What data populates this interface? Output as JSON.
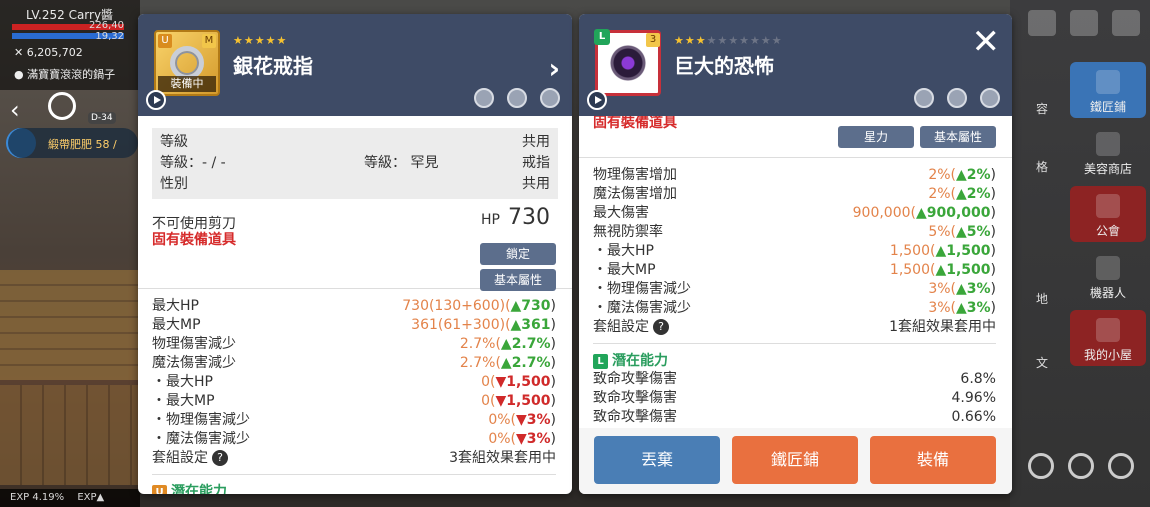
{
  "hud": {
    "level": "LV.252 Carry醬",
    "hp": "226,40",
    "mp": "19,32",
    "money": "6,205,702",
    "map": "滿寶寶滾滾的鍋子",
    "dday": "D-34",
    "quest": "緞帶肥肥 58 /",
    "exp": "EXP 4.19%",
    "exp2": "EXP▲"
  },
  "side_menu": {
    "blacksmith": "鐵匠鋪",
    "beauty": "美容商店",
    "guild": "公會",
    "robot": "機器人",
    "house": "我的小屋",
    "partial": [
      "容",
      "格",
      "地",
      "文"
    ]
  },
  "left_item": {
    "stars": "★★★★★",
    "name": "銀花戒指",
    "equipped_tag": "裝備中",
    "badge_u": "U",
    "badge_m": "M",
    "req": [
      {
        "left": "等級",
        "mid": "",
        "right": "共用"
      },
      {
        "left": "等級：- / -",
        "mid": "等級： 罕見",
        "right": "戒指"
      },
      {
        "left": "性別",
        "mid": "",
        "right": "共用"
      }
    ],
    "no_scissors": "不可使用剪刀",
    "unique_equip": "固有裝備道具",
    "hp_label": "HP",
    "hp_value": "730",
    "lock_btn": "鎖定",
    "basic_btn": "基本屬性",
    "stats": [
      {
        "label": "最大HP",
        "o": "730(130+600)(",
        "g": "▲730",
        "r": "",
        "end": ")"
      },
      {
        "label": "最大MP",
        "o": "361(61+300)(",
        "g": "▲361",
        "r": "",
        "end": ")"
      },
      {
        "label": "物理傷害減少",
        "o": "2.7%(",
        "g": "▲2.7%",
        "r": "",
        "end": ")"
      },
      {
        "label": "魔法傷害減少",
        "o": "2.7%(",
        "g": "▲2.7%",
        "r": "",
        "end": ")"
      },
      {
        "label": "・最大HP",
        "o": "0(",
        "g": "",
        "r": "▼1,500",
        "end": ")"
      },
      {
        "label": "・最大MP",
        "o": "0(",
        "g": "",
        "r": "▼1,500",
        "end": ")"
      },
      {
        "label": "・物理傷害減少",
        "o": "0%(",
        "g": "",
        "r": "▼3%",
        "end": ")"
      },
      {
        "label": "・魔法傷害減少",
        "o": "0%(",
        "g": "",
        "r": "▼3%",
        "end": ")"
      }
    ],
    "set_label": "套組設定",
    "set_value": "3套組效果套用中",
    "potential_title": "潛在能力"
  },
  "right_item": {
    "stars_on": "★★★",
    "stars_off": "★★★★★★★",
    "name": "巨大的恐怖",
    "badge_l": "L",
    "badge_3": "3",
    "unique_equip": "固有裝備道具",
    "starforce_btn": "星力",
    "basic_btn": "基本屬性",
    "stats": [
      {
        "label": "物理傷害增加",
        "o": "2%(",
        "g": "▲2%",
        "end": ")"
      },
      {
        "label": "魔法傷害增加",
        "o": "2%(",
        "g": "▲2%",
        "end": ")"
      },
      {
        "label": "最大傷害",
        "o": "900,000(",
        "g": "▲900,000",
        "end": ")"
      },
      {
        "label": "無視防禦率",
        "o": "5%(",
        "g": "▲5%",
        "end": ")"
      },
      {
        "label": "・最大HP",
        "o": "1,500(",
        "g": "▲1,500",
        "end": ")"
      },
      {
        "label": "・最大MP",
        "o": "1,500(",
        "g": "▲1,500",
        "end": ")"
      },
      {
        "label": "・物理傷害減少",
        "o": "3%(",
        "g": "▲3%",
        "end": ")"
      },
      {
        "label": "・魔法傷害減少",
        "o": "3%(",
        "g": "▲3%",
        "end": ")"
      }
    ],
    "set_label": "套組設定",
    "set_value": "1套組效果套用中",
    "potential_title": "潛在能力",
    "potentials": [
      {
        "label": "致命攻擊傷害",
        "value": "6.8%"
      },
      {
        "label": "致命攻擊傷害",
        "value": "4.96%"
      },
      {
        "label": "致命攻擊傷害",
        "value": "0.66%"
      }
    ],
    "footer": {
      "discard": "丟棄",
      "smith": "鐵匠鋪",
      "equip": "裝備"
    }
  },
  "colors": {
    "header_bg": "#3e4b66",
    "positive": "#3aa63a",
    "negative": "#d02a2a",
    "value_orange": "#e3834a",
    "discard_btn": "#4a7eb5",
    "action_btn": "#e9703f"
  }
}
